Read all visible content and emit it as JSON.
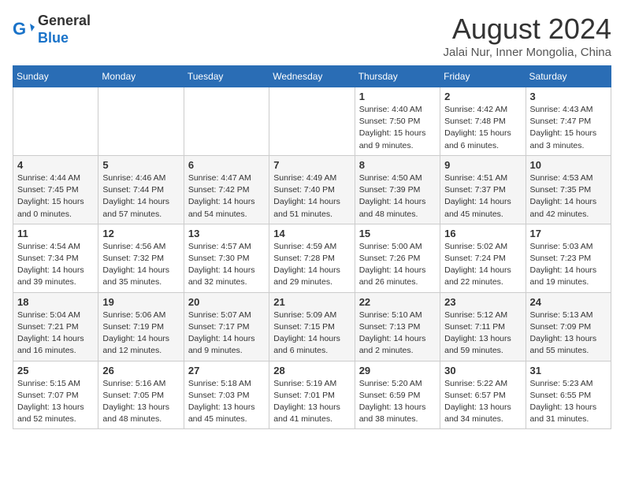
{
  "header": {
    "logo_general": "General",
    "logo_blue": "Blue",
    "month_year": "August 2024",
    "location": "Jalai Nur, Inner Mongolia, China"
  },
  "weekdays": [
    "Sunday",
    "Monday",
    "Tuesday",
    "Wednesday",
    "Thursday",
    "Friday",
    "Saturday"
  ],
  "weeks": [
    [
      {
        "day": "",
        "detail": ""
      },
      {
        "day": "",
        "detail": ""
      },
      {
        "day": "",
        "detail": ""
      },
      {
        "day": "",
        "detail": ""
      },
      {
        "day": "1",
        "detail": "Sunrise: 4:40 AM\nSunset: 7:50 PM\nDaylight: 15 hours\nand 9 minutes."
      },
      {
        "day": "2",
        "detail": "Sunrise: 4:42 AM\nSunset: 7:48 PM\nDaylight: 15 hours\nand 6 minutes."
      },
      {
        "day": "3",
        "detail": "Sunrise: 4:43 AM\nSunset: 7:47 PM\nDaylight: 15 hours\nand 3 minutes."
      }
    ],
    [
      {
        "day": "4",
        "detail": "Sunrise: 4:44 AM\nSunset: 7:45 PM\nDaylight: 15 hours\nand 0 minutes."
      },
      {
        "day": "5",
        "detail": "Sunrise: 4:46 AM\nSunset: 7:44 PM\nDaylight: 14 hours\nand 57 minutes."
      },
      {
        "day": "6",
        "detail": "Sunrise: 4:47 AM\nSunset: 7:42 PM\nDaylight: 14 hours\nand 54 minutes."
      },
      {
        "day": "7",
        "detail": "Sunrise: 4:49 AM\nSunset: 7:40 PM\nDaylight: 14 hours\nand 51 minutes."
      },
      {
        "day": "8",
        "detail": "Sunrise: 4:50 AM\nSunset: 7:39 PM\nDaylight: 14 hours\nand 48 minutes."
      },
      {
        "day": "9",
        "detail": "Sunrise: 4:51 AM\nSunset: 7:37 PM\nDaylight: 14 hours\nand 45 minutes."
      },
      {
        "day": "10",
        "detail": "Sunrise: 4:53 AM\nSunset: 7:35 PM\nDaylight: 14 hours\nand 42 minutes."
      }
    ],
    [
      {
        "day": "11",
        "detail": "Sunrise: 4:54 AM\nSunset: 7:34 PM\nDaylight: 14 hours\nand 39 minutes."
      },
      {
        "day": "12",
        "detail": "Sunrise: 4:56 AM\nSunset: 7:32 PM\nDaylight: 14 hours\nand 35 minutes."
      },
      {
        "day": "13",
        "detail": "Sunrise: 4:57 AM\nSunset: 7:30 PM\nDaylight: 14 hours\nand 32 minutes."
      },
      {
        "day": "14",
        "detail": "Sunrise: 4:59 AM\nSunset: 7:28 PM\nDaylight: 14 hours\nand 29 minutes."
      },
      {
        "day": "15",
        "detail": "Sunrise: 5:00 AM\nSunset: 7:26 PM\nDaylight: 14 hours\nand 26 minutes."
      },
      {
        "day": "16",
        "detail": "Sunrise: 5:02 AM\nSunset: 7:24 PM\nDaylight: 14 hours\nand 22 minutes."
      },
      {
        "day": "17",
        "detail": "Sunrise: 5:03 AM\nSunset: 7:23 PM\nDaylight: 14 hours\nand 19 minutes."
      }
    ],
    [
      {
        "day": "18",
        "detail": "Sunrise: 5:04 AM\nSunset: 7:21 PM\nDaylight: 14 hours\nand 16 minutes."
      },
      {
        "day": "19",
        "detail": "Sunrise: 5:06 AM\nSunset: 7:19 PM\nDaylight: 14 hours\nand 12 minutes."
      },
      {
        "day": "20",
        "detail": "Sunrise: 5:07 AM\nSunset: 7:17 PM\nDaylight: 14 hours\nand 9 minutes."
      },
      {
        "day": "21",
        "detail": "Sunrise: 5:09 AM\nSunset: 7:15 PM\nDaylight: 14 hours\nand 6 minutes."
      },
      {
        "day": "22",
        "detail": "Sunrise: 5:10 AM\nSunset: 7:13 PM\nDaylight: 14 hours\nand 2 minutes."
      },
      {
        "day": "23",
        "detail": "Sunrise: 5:12 AM\nSunset: 7:11 PM\nDaylight: 13 hours\nand 59 minutes."
      },
      {
        "day": "24",
        "detail": "Sunrise: 5:13 AM\nSunset: 7:09 PM\nDaylight: 13 hours\nand 55 minutes."
      }
    ],
    [
      {
        "day": "25",
        "detail": "Sunrise: 5:15 AM\nSunset: 7:07 PM\nDaylight: 13 hours\nand 52 minutes."
      },
      {
        "day": "26",
        "detail": "Sunrise: 5:16 AM\nSunset: 7:05 PM\nDaylight: 13 hours\nand 48 minutes."
      },
      {
        "day": "27",
        "detail": "Sunrise: 5:18 AM\nSunset: 7:03 PM\nDaylight: 13 hours\nand 45 minutes."
      },
      {
        "day": "28",
        "detail": "Sunrise: 5:19 AM\nSunset: 7:01 PM\nDaylight: 13 hours\nand 41 minutes."
      },
      {
        "day": "29",
        "detail": "Sunrise: 5:20 AM\nSunset: 6:59 PM\nDaylight: 13 hours\nand 38 minutes."
      },
      {
        "day": "30",
        "detail": "Sunrise: 5:22 AM\nSunset: 6:57 PM\nDaylight: 13 hours\nand 34 minutes."
      },
      {
        "day": "31",
        "detail": "Sunrise: 5:23 AM\nSunset: 6:55 PM\nDaylight: 13 hours\nand 31 minutes."
      }
    ]
  ]
}
